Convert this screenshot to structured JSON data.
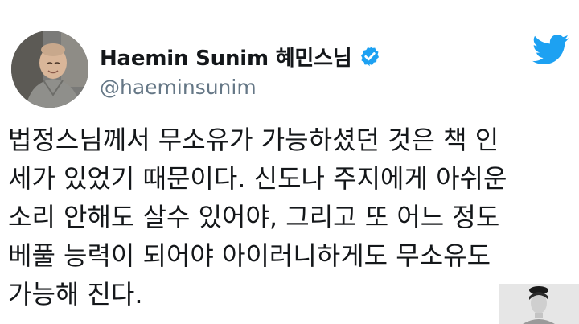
{
  "tweet": {
    "author": {
      "display_name": "Haemin Sunim 혜민스님",
      "handle": "@haeminsunim",
      "verified": true,
      "avatar_icon": "monk-portrait-avatar"
    },
    "platform_icon": "twitter-bird-icon",
    "body_lines": [
      "법정스님께서 무소유가 가능하셨던 것은 책 인",
      "세가 있었기 때문이다. 신도나 주지에게 아쉬운",
      "소리 안해도 살수 있어야, 그리고 또 어느 정도",
      "베풀 능력이 되어야 아이러니하게도 무소유도",
      "가능해 진다."
    ]
  },
  "colors": {
    "twitter_blue": "#1da1f2",
    "handle_gray": "#657786",
    "text": "#14171a"
  }
}
